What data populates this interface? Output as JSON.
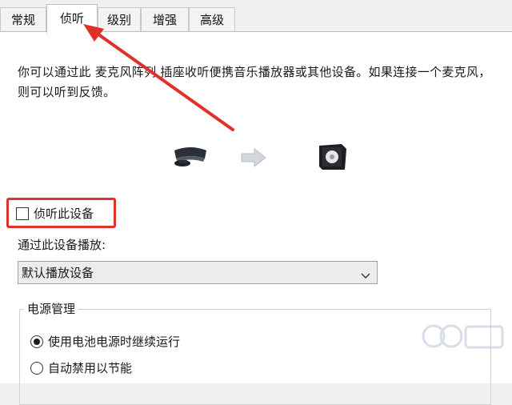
{
  "tabs": [
    {
      "label": "常规",
      "active": false
    },
    {
      "label": "侦听",
      "active": true
    },
    {
      "label": "级别",
      "active": false
    },
    {
      "label": "增强",
      "active": false
    },
    {
      "label": "高级",
      "active": false
    }
  ],
  "listen": {
    "description": "你可以通过此 麦克风阵列 插座收听便携音乐播放器或其他设备。如果连接一个麦克风，则可以听到反馈。",
    "checkbox_label": "侦听此设备",
    "checkbox_checked": false,
    "playback_label": "通过此设备播放:",
    "playback_value": "默认播放设备"
  },
  "power": {
    "group_title": "电源管理",
    "options": [
      {
        "label": "使用电池电源时继续运行",
        "selected": true
      },
      {
        "label": "自动禁用以节能",
        "selected": false
      }
    ]
  },
  "icons": {
    "source_device": "microphone-device-icon",
    "flow_arrow": "right-arrow-icon",
    "target_device": "speaker-device-icon"
  },
  "colors": {
    "annotation_red": "#e0302a",
    "tab_active_bg": "#ffffff",
    "dialog_bg": "#f0f0f0"
  }
}
